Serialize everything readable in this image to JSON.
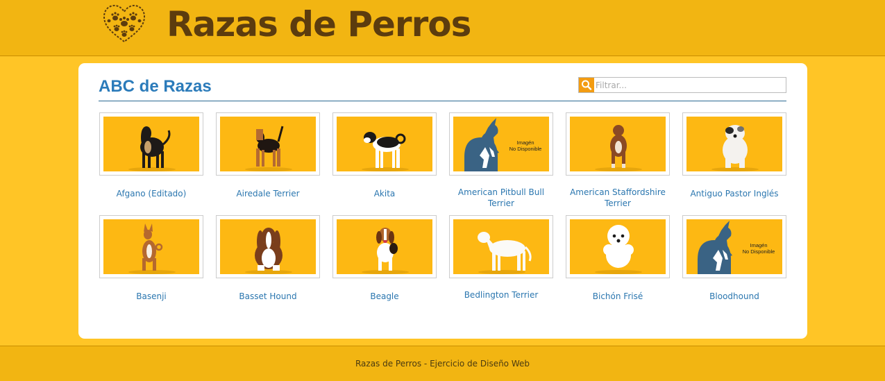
{
  "header": {
    "title": "Razas de Perros",
    "logo_icon": "paw-heart-icon"
  },
  "main": {
    "heading": "ABC de Razas",
    "filter": {
      "placeholder": "Filtrar...",
      "value": "",
      "icon": "search-icon"
    },
    "breeds": [
      {
        "name": "Afgano (Editado)",
        "image": "afghan-hound"
      },
      {
        "name": "Airedale Terrier",
        "image": "airedale-terrier"
      },
      {
        "name": "Akita",
        "image": "akita"
      },
      {
        "name": "American Pitbull Bull Terrier",
        "image": "placeholder",
        "placeholder_text": [
          "Imagén",
          "No Disponible"
        ]
      },
      {
        "name": "American Staffordshire Terrier",
        "image": "american-staffordshire"
      },
      {
        "name": "Antiguo Pastor Inglés",
        "image": "old-english-sheepdog"
      },
      {
        "name": "Basenji",
        "image": "basenji"
      },
      {
        "name": "Basset Hound",
        "image": "basset-hound"
      },
      {
        "name": "Beagle",
        "image": "beagle"
      },
      {
        "name": "Bedlington Terrier",
        "image": "bedlington-terrier"
      },
      {
        "name": "Bichón Frisé",
        "image": "bichon-frise"
      },
      {
        "name": "Bloodhound",
        "image": "placeholder",
        "placeholder_text": [
          "Imagén",
          "No Disponible"
        ]
      }
    ]
  },
  "footer": {
    "text": "Razas de Perros - Ejercicio de Diseño Web"
  },
  "colors": {
    "header_bg": "#F2B512",
    "page_bg": "#FFC526",
    "accent_blue": "#2B7BBA",
    "thumb_bg": "#FDB813",
    "filter_icon_bg": "#F39C12",
    "placeholder_blue": "#3A6384"
  }
}
